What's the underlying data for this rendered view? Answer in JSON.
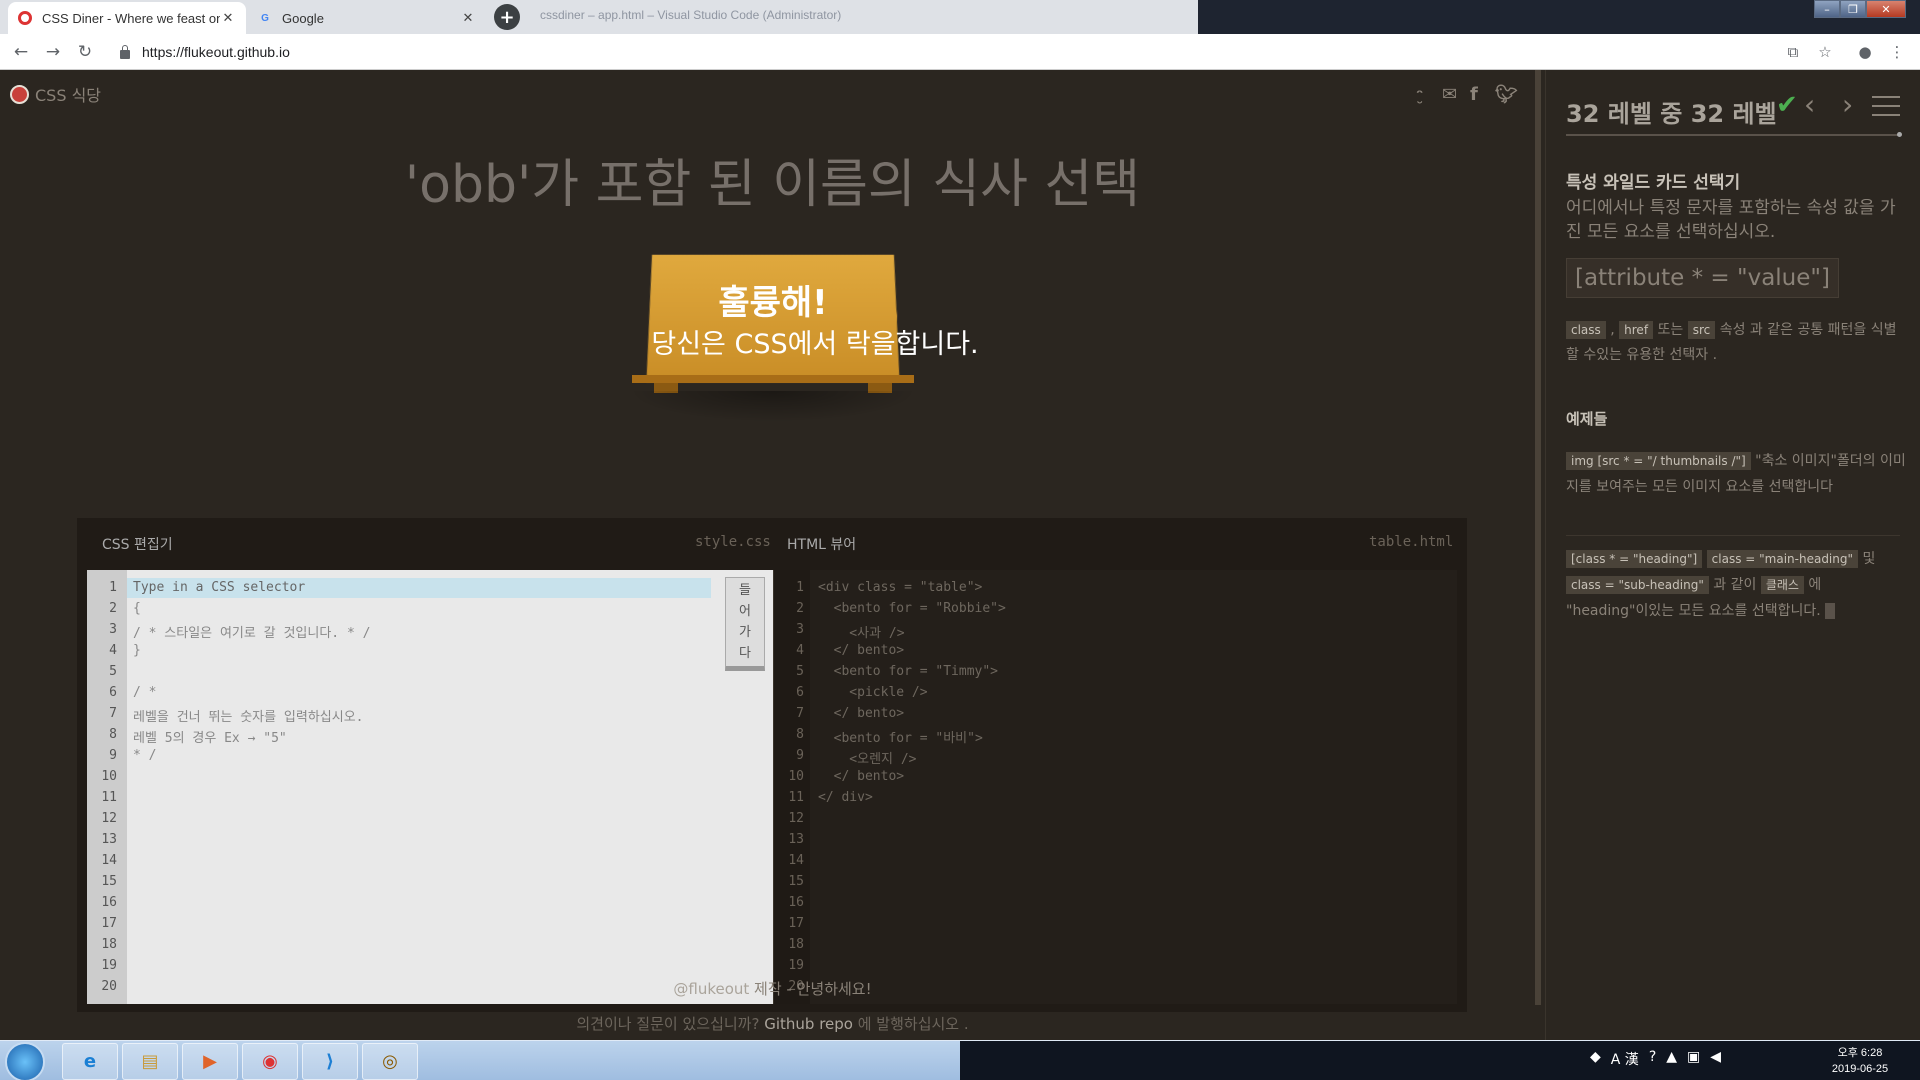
{
  "browser": {
    "tabs": [
      {
        "title": "CSS Diner - Where we feast on",
        "active": true
      },
      {
        "title": "Google",
        "active": false
      }
    ],
    "url": "https://flukeout.github.io",
    "background_window_title": "cssdiner – app.html – Visual Studio Code (Administrator)"
  },
  "game": {
    "logo": "CSS 식당",
    "share_icons": [
      "wink-icon",
      "mail-icon",
      "facebook-icon",
      "twitter-icon"
    ],
    "order": "'obb'가 포함 된 이름의 식사 선택",
    "congrats_title": "훌륭해!",
    "congrats_sub": "당신은 CSS에서 락을합니다.",
    "css_editor": {
      "title": "CSS 편집기",
      "file": "style.css",
      "enter_button": [
        "들",
        "어",
        "가",
        "다"
      ],
      "line_numbers": [
        "1",
        "2",
        "3",
        "4",
        "5",
        "6",
        "7",
        "8",
        "9",
        "10",
        "11",
        "12",
        "13",
        "14",
        "15",
        "16",
        "17",
        "18",
        "19",
        "20"
      ],
      "lines": [
        "Type in a CSS selector",
        "{",
        "/ * 스타일은 여기로 갈 것입니다. * /",
        "}",
        "",
        "/ *",
        "레벨을 건너 뛰는 숫자를 입력하십시오.",
        "레벨 5의 경우 Ex → \"5\"",
        "* /"
      ]
    },
    "html_viewer": {
      "title": "HTML 뷰어",
      "file": "table.html",
      "lines": [
        "<div class = \"table\">",
        "  <bento for = \"Robbie\">",
        "    <사과 />",
        "  </ bento>",
        "  <bento for = \"Timmy\">",
        "    <pickle />",
        "  </ bento>",
        "  <bento for = \"바비\">",
        "    <오렌지 />",
        "  </ bento>",
        "</ div>"
      ]
    },
    "footer_credit_author": "@flukeout",
    "footer_credit_rest": " 제작 - 안녕하세요!",
    "footer_feedback_pre": "의견이나 질문이 있으십니까? ",
    "footer_feedback_link": "Github repo",
    "footer_feedback_post": " 에 발행하십시오 ."
  },
  "sidebar": {
    "level": "32 레벨 중 32 레벨",
    "selector_name": "특성 와일드 카드 선택기",
    "selector_desc": "어디에서나 특정 문자를 포함하는 속성 값을 가진 모든 요소를 선택하십시오.",
    "syntax": "[attribute * = \"value\"]",
    "hint": {
      "tag1": "class",
      "sep1": " , ",
      "tag2": "href",
      "mid": " 또는 ",
      "tag3": "src",
      "rest": " 속성 과 같은 공통 패턴을 식별 할 수있는 유용한 선택자 ."
    },
    "examples_title": "예제들",
    "example1": {
      "code": "img [src * = \"/ thumbnails /\"]",
      "text": " \"축소 이미지\"폴더의 이미지를 보여주는 모든 이미지 요소를 선택합니다"
    },
    "example2": {
      "code1": "[class * = \"heading\"]",
      "code2": "class = \"main-heading\"",
      "and": " 및",
      "code3": "class = \"sub-heading\"",
      "mid": " 과 같이 ",
      "code4": "클래스",
      "rest": " 에 \"heading\"이있는 모든 요소를 선택합니다."
    }
  },
  "taskbar": {
    "apps": [
      "start-button",
      "ie-icon",
      "explorer-icon",
      "media-icon",
      "chrome-icon",
      "vscode-icon",
      "web-app-icon"
    ],
    "tray_ime": "A 漢",
    "clock_time": "오후 6:28",
    "clock_date": "2019-06-25"
  },
  "colors": {
    "page_bg": "#2b2620",
    "table": "#d89e38",
    "check": "#4caf50",
    "logo_dot": "#c8413b"
  }
}
